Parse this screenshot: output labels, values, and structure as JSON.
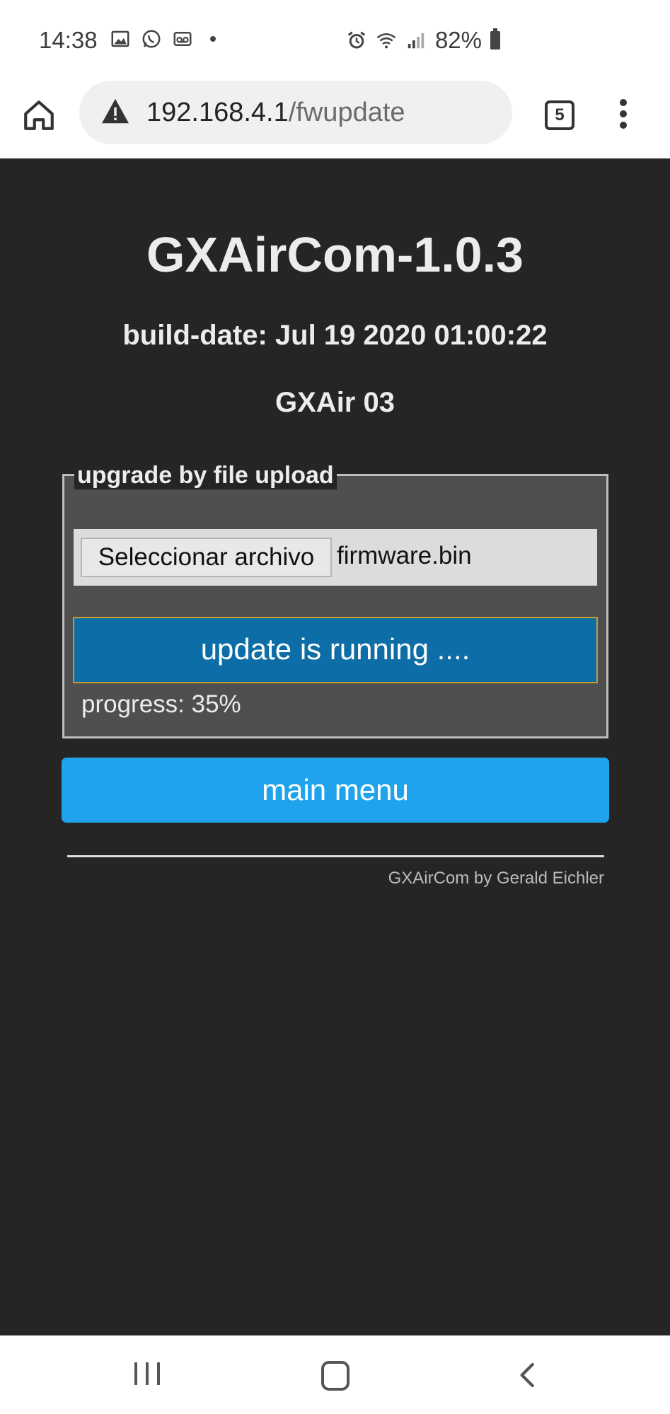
{
  "status_bar": {
    "time": "14:38",
    "battery": "82%",
    "icons": [
      "image-icon",
      "whatsapp-icon",
      "voicemail-icon",
      "dot-icon",
      "alarm-icon",
      "wifi-icon",
      "signal-icon",
      "battery-icon"
    ]
  },
  "browser": {
    "url_host": "192.168.4.1",
    "url_path": "/fwupdate",
    "tab_count": "5"
  },
  "page": {
    "title": "GXAirCom-1.0.3",
    "build_date": "build-date: Jul 19 2020 01:00:22",
    "device_name": "GXAir 03",
    "upload_legend": "upgrade by file upload",
    "file_button_label": "Seleccionar archivo",
    "file_name": "firmware.bin",
    "update_button_label": "update is running ....",
    "progress_text": "progress: 35%",
    "main_menu_label": "main menu",
    "footer": "GXAirCom by Gerald Eichler"
  },
  "colors": {
    "page_bg": "#252525",
    "fieldset_bg": "#4f4f4f",
    "update_button": "#0d6ea7",
    "main_menu_button": "#1fa3ec"
  }
}
